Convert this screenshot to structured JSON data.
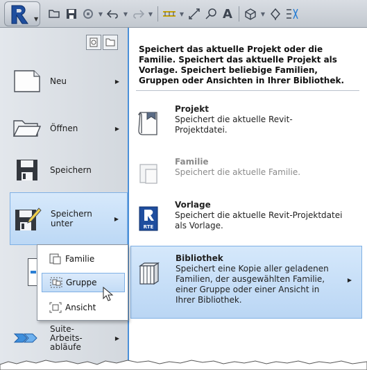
{
  "toolbar": {
    "icons": [
      "open-icon",
      "save-icon",
      "sync-icon",
      "undo-icon",
      "redo-icon",
      "measure-icon",
      "dimension-icon",
      "tag-icon",
      "text-icon",
      "3d-view-icon",
      "section-icon",
      "thin-lines-icon"
    ]
  },
  "left_menu": {
    "items": [
      {
        "id": "neu",
        "label": "Neu",
        "has_submenu": true
      },
      {
        "id": "oeffnen",
        "label": "Öffnen",
        "has_submenu": true
      },
      {
        "id": "speichern",
        "label": "Speichern",
        "has_submenu": false
      },
      {
        "id": "speichern_unter",
        "label_line1": "Speichern",
        "label_line2": "unter",
        "has_submenu": true,
        "highlighted": true
      },
      {
        "id": "suite",
        "label_line1": "Suite-",
        "label_line2": "Arbeits-",
        "label_line3": "abläufe",
        "has_submenu": true
      }
    ]
  },
  "submenu": {
    "items": [
      {
        "label": "Familie",
        "selected": false
      },
      {
        "label": "Gruppe",
        "selected": true
      },
      {
        "label": "Ansicht",
        "selected": false
      }
    ]
  },
  "panel": {
    "intro": "Speichert das aktuelle Projekt oder die Familie. Speichert das aktuelle Projekt als Vorlage. Speichert beliebige Familien, Gruppen oder Ansichten in Ihrer Bibliothek.",
    "options": [
      {
        "title": "Projekt",
        "line1": "Speichert die aktuelle Revit-",
        "line2": "Projektdatei.",
        "line3": "",
        "line4": "",
        "disabled": false
      },
      {
        "title": "Familie",
        "line1": "Speichert die aktuelle Familie.",
        "line2": "",
        "line3": "",
        "line4": "",
        "disabled": true
      },
      {
        "title": "Vorlage",
        "line1": "Speichert die aktuelle Revit-Projektdatei",
        "line2": "als Vorlage.",
        "line3": "",
        "line4": "",
        "disabled": false,
        "icon_text": "RTE"
      },
      {
        "title": "Bibliothek",
        "line1": "Speichert eine Kopie aller geladenen",
        "line2": "Familien, der ausgewählten Familie,",
        "line3": "einer Gruppe oder einer Ansicht in",
        "line4": "Ihrer Bibliothek.",
        "disabled": false,
        "selected": true
      }
    ]
  },
  "colors": {
    "highlight": "#bcd8f5",
    "highlight_border": "#7fb0e4",
    "panel_border": "#4a8fd8",
    "revit_blue": "#1f4e9e"
  }
}
